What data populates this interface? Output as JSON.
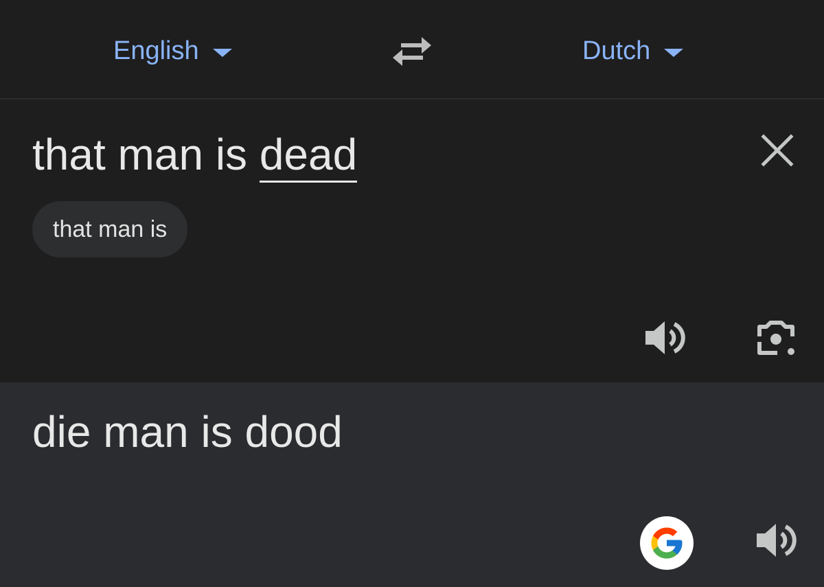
{
  "lang_bar": {
    "source_language": "English",
    "target_language": "Dutch",
    "swap_icon": "swap-arrows-icon"
  },
  "source": {
    "text_prefix": "that man is ",
    "text_underlined": "dead",
    "suggestion": "that man is",
    "clear_icon": "close-icon",
    "speaker_icon": "speaker-icon",
    "camera_icon": "camera-lens-icon"
  },
  "translation": {
    "text": "die man is dood",
    "google_icon": "google-g-icon",
    "speaker_icon": "speaker-icon"
  },
  "colors": {
    "background": "#1e1e1f",
    "translation_background": "#2b2c2f",
    "accent": "#8ab4f8",
    "text": "#e8e8e8",
    "chip": "#2d2e30"
  }
}
